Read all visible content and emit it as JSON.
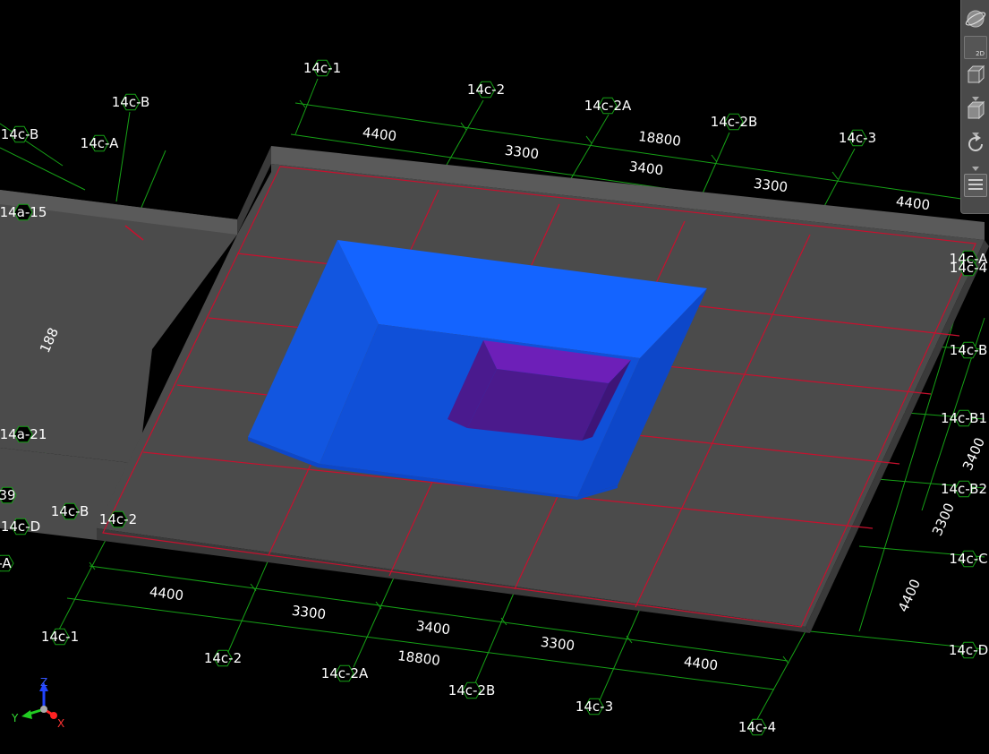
{
  "top_grid_labels": [
    "14c-1",
    "14c-2",
    "14c-2A",
    "14c-2B",
    "14c-3",
    "14c-B",
    "14c-A"
  ],
  "left_grid_labels": [
    "14c-B",
    "14a-15",
    "14a-21",
    "39",
    "14c-D",
    "14c-B",
    "14c-2",
    "-A"
  ],
  "right_grid_labels": [
    "14c-A",
    "14c-4",
    "14c-B",
    "14c-B1",
    "14c-B2",
    "14c-C",
    "14c-D"
  ],
  "bottom_grid_labels": [
    "14c-1",
    "14c-2",
    "14c-2A",
    "14c-2B",
    "14c-3",
    "14c-4"
  ],
  "top_dimensions": [
    "4400",
    "3300",
    "3400",
    "3300",
    "4400"
  ],
  "top_total": "18800",
  "bottom_dimensions": [
    "4400",
    "3300",
    "3400",
    "3300",
    "4400"
  ],
  "bottom_total": "18800",
  "right_dimensions": [
    "3400",
    "3300",
    "4400"
  ],
  "left_dimension_partial": "188",
  "axes": {
    "x": "X",
    "y": "Y",
    "z": "Z"
  },
  "view_toolbar": {
    "mode_2d": "2D",
    "buttons": [
      "orbit-globe-icon",
      "view-2d-icon",
      "view-cube-icon",
      "view-cube-solid-icon",
      "rotate-icon",
      "layers-menu-icon"
    ]
  },
  "colors": {
    "background": "#000000",
    "slab": "#4b4b4b",
    "slab_edge": "#5a5a5a",
    "grid_red": "#c8102e",
    "grid_green": "#16a116",
    "pit_blue": "#1464ff",
    "pit_inner": "#6d1fb8"
  }
}
